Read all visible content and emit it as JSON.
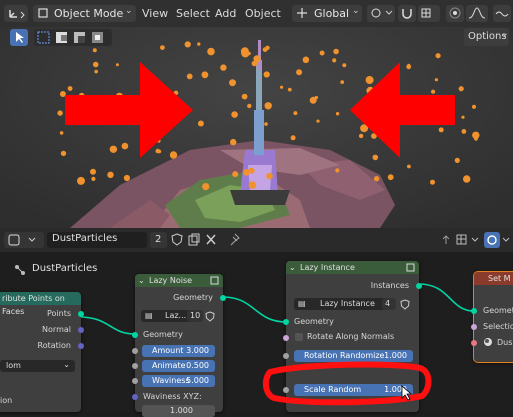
{
  "viewport_header": {
    "mode": "Object Mode",
    "menus": [
      "View",
      "Select",
      "Add",
      "Object"
    ],
    "orientation": "Global",
    "options_label": "Options"
  },
  "node_editor_header": {
    "tree_name": "DustParticles",
    "user_count": "2"
  },
  "breadcrumb": "DustParticles",
  "nodes": {
    "distribute": {
      "title": "ribute Points on Faces",
      "outputs": [
        "Points",
        "Normal",
        "Rotation"
      ],
      "dropdown": "lom",
      "label_bottom": "ion"
    },
    "lazy_noise": {
      "title": "Lazy Noise",
      "output": "Geometry",
      "selector_value": "Laz...",
      "selector_count": "10",
      "input": "Geometry",
      "fields": [
        {
          "label": "Amount",
          "value": "3.000"
        },
        {
          "label": "Animate",
          "value": "0.500"
        },
        {
          "label": "Waviness",
          "value": "5.000"
        }
      ],
      "extra_label": "Waviness XYZ:",
      "extra_value": "1.000"
    },
    "lazy_instance": {
      "title": "Lazy Instance",
      "output": "Instances",
      "selector_value": "Lazy Instance",
      "selector_count": "4",
      "input": "Geometry",
      "checkbox_label": "Rotate Along Normals",
      "fields": [
        {
          "label": "Rotation Randomize",
          "value": "1.000"
        },
        {
          "label": "Scale Random",
          "value": "1.000"
        }
      ]
    },
    "set_material": {
      "title": "Set M",
      "inputs": [
        "Geometr",
        "Selection",
        "Dus"
      ]
    }
  },
  "colors": {
    "accent_blue": "#4772b3",
    "arrow_red": "#ff0000",
    "geometry_socket": "#00d6a3",
    "particle_orange": "#f0922e"
  }
}
